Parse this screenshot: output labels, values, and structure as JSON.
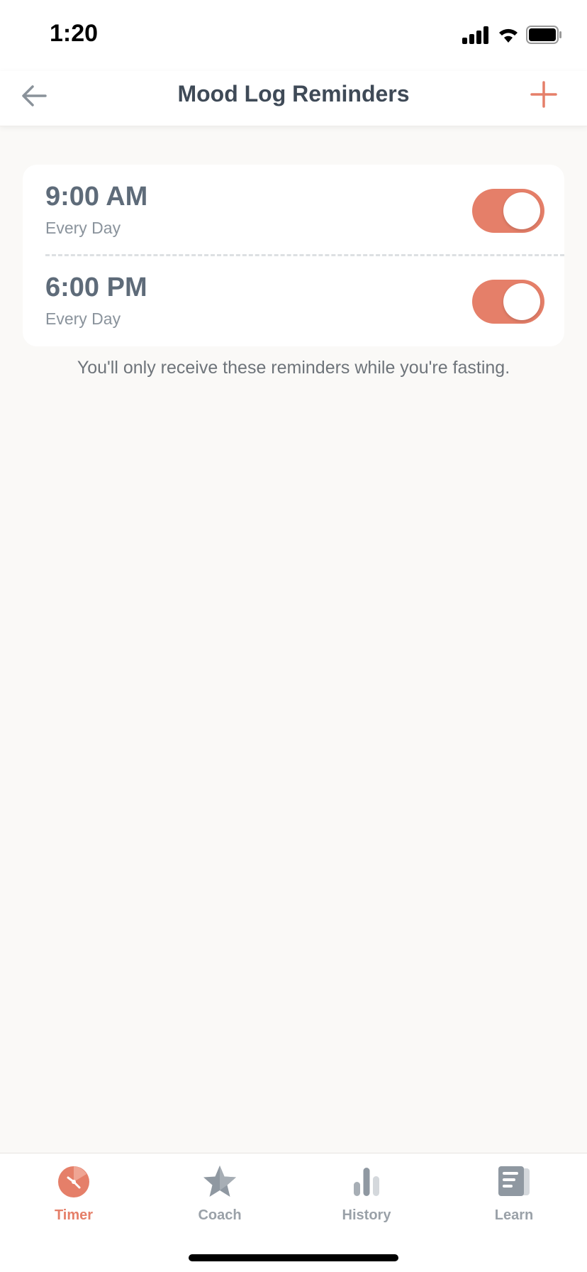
{
  "status_bar": {
    "time": "1:20"
  },
  "header": {
    "title": "Mood Log Reminders",
    "back_icon": "arrow-left-icon",
    "add_icon": "plus-icon"
  },
  "reminders": [
    {
      "time": "9:00 AM",
      "repeat": "Every Day",
      "enabled": true
    },
    {
      "time": "6:00 PM",
      "repeat": "Every Day",
      "enabled": true
    }
  ],
  "note": "You'll only receive these reminders while you're fasting.",
  "tabs": [
    {
      "label": "Timer",
      "icon": "timer-icon",
      "active": true
    },
    {
      "label": "Coach",
      "icon": "star-icon",
      "active": false
    },
    {
      "label": "History",
      "icon": "bar-chart-icon",
      "active": false
    },
    {
      "label": "Learn",
      "icon": "article-icon",
      "active": false
    }
  ],
  "colors": {
    "accent": "#E57F69",
    "title_text": "#3F4A57",
    "time_text": "#5E6B79",
    "background": "#FAF9F7"
  }
}
